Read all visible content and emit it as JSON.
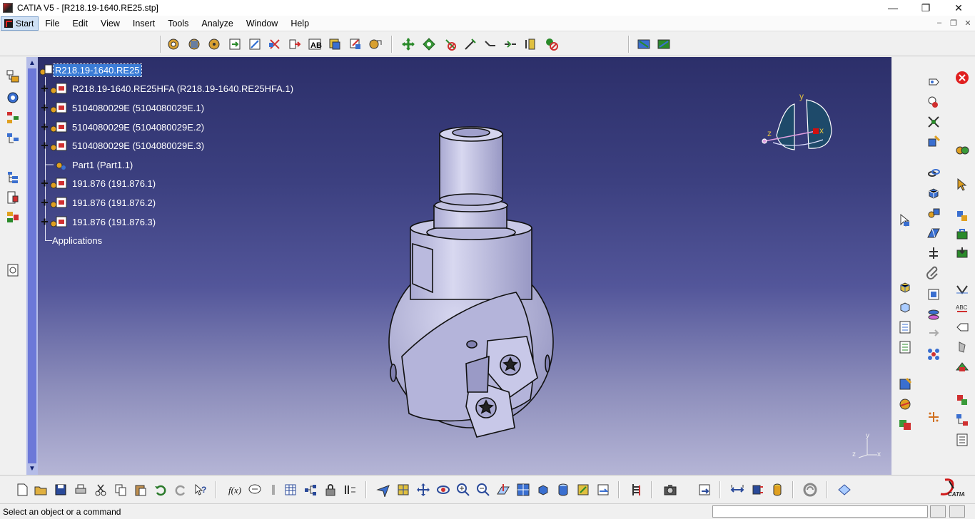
{
  "window": {
    "title": "CATIA V5 - [R218.19-1640.RE25.stp]",
    "minimize": "—",
    "maximize": "❐",
    "close": "✕"
  },
  "menu": {
    "start": "Start",
    "items": [
      "File",
      "Edit",
      "View",
      "Insert",
      "Tools",
      "Analyze",
      "Window",
      "Help"
    ],
    "doc_min": "–",
    "doc_restore": "❐",
    "doc_close": "✕"
  },
  "tree": {
    "root": "R218.19-1640.RE25",
    "children": [
      {
        "label": "R218.19-1640.RE25HFA (R218.19-1640.RE25HFA.1)",
        "expandable": true
      },
      {
        "label": "5104080029E (5104080029E.1)",
        "expandable": true
      },
      {
        "label": "5104080029E (5104080029E.2)",
        "expandable": true
      },
      {
        "label": "5104080029E (5104080029E.3)",
        "expandable": true
      },
      {
        "label": "Part1 (Part1.1)",
        "expandable": false
      },
      {
        "label": "191.876 (191.876.1)",
        "expandable": true
      },
      {
        "label": "191.876 (191.876.2)",
        "expandable": true
      },
      {
        "label": "191.876 (191.876.3)",
        "expandable": true
      }
    ],
    "applications": "Applications"
  },
  "compass": {
    "x": "x",
    "y": "y",
    "z": "z"
  },
  "axis_triad": {
    "x": "x",
    "y": "y",
    "z": "z"
  },
  "status": {
    "message": "Select an object or a command",
    "command_input": ""
  },
  "colors": {
    "background_top": "#2c2f6a",
    "background_bottom": "#b5b5d6",
    "model": "#c9c9e8",
    "selection": "#3a7bd5"
  },
  "catia_logo": "CATIA"
}
